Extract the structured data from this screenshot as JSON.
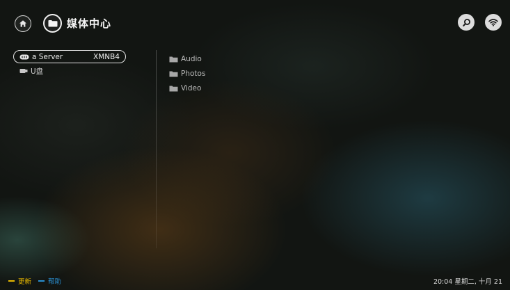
{
  "header": {
    "home_icon": "home-icon",
    "folder_icon": "folder-icon",
    "title": "媒体中心",
    "search_icon": "search-icon",
    "wifi_icon": "wifi-icon"
  },
  "devices": [
    {
      "icon": "network-server-icon",
      "name": "a Server",
      "tag": "XMNB4",
      "selected": true
    },
    {
      "icon": "usb-drive-icon",
      "name": "U盘",
      "tag": "",
      "selected": false
    }
  ],
  "folders": [
    {
      "icon": "folder-icon",
      "label": "Audio"
    },
    {
      "icon": "folder-icon",
      "label": "Photos"
    },
    {
      "icon": "folder-icon",
      "label": "Video"
    }
  ],
  "footer": {
    "update_label": "更新",
    "update_color": "#e8b800",
    "help_label": "帮助",
    "help_color": "#2a8fd0",
    "clock_text": "20:04  星期二, 十月 21"
  }
}
